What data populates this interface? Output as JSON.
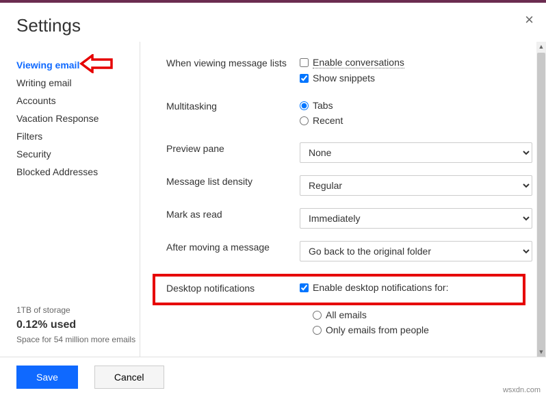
{
  "dialog": {
    "title": "Settings"
  },
  "sidebar": {
    "items": [
      {
        "label": "Viewing email",
        "active": true
      },
      {
        "label": "Writing email",
        "active": false
      },
      {
        "label": "Accounts",
        "active": false
      },
      {
        "label": "Vacation Response",
        "active": false
      },
      {
        "label": "Filters",
        "active": false
      },
      {
        "label": "Security",
        "active": false
      },
      {
        "label": "Blocked Addresses",
        "active": false
      }
    ]
  },
  "storage": {
    "total": "1TB of storage",
    "percent": "0.12% used",
    "remaining": "Space for 54 million more emails"
  },
  "settings": {
    "messageLists": {
      "label": "When viewing message lists",
      "enableConversations": {
        "label": "Enable conversations",
        "checked": false
      },
      "showSnippets": {
        "label": "Show snippets",
        "checked": true
      }
    },
    "multitasking": {
      "label": "Multitasking",
      "options": [
        {
          "label": "Tabs",
          "selected": true
        },
        {
          "label": "Recent",
          "selected": false
        }
      ]
    },
    "previewPane": {
      "label": "Preview pane",
      "value": "None"
    },
    "messageListDensity": {
      "label": "Message list density",
      "value": "Regular"
    },
    "markAsRead": {
      "label": "Mark as read",
      "value": "Immediately"
    },
    "afterMoving": {
      "label": "After moving a message",
      "value": "Go back to the original folder"
    },
    "desktopNotifications": {
      "label": "Desktop notifications",
      "enable": {
        "label": "Enable desktop notifications for:",
        "checked": true
      },
      "options": [
        {
          "label": "All emails",
          "selected": false
        },
        {
          "label": "Only emails from people",
          "selected": false
        }
      ]
    }
  },
  "footer": {
    "save": "Save",
    "cancel": "Cancel"
  },
  "watermark": "wsxdn.com"
}
